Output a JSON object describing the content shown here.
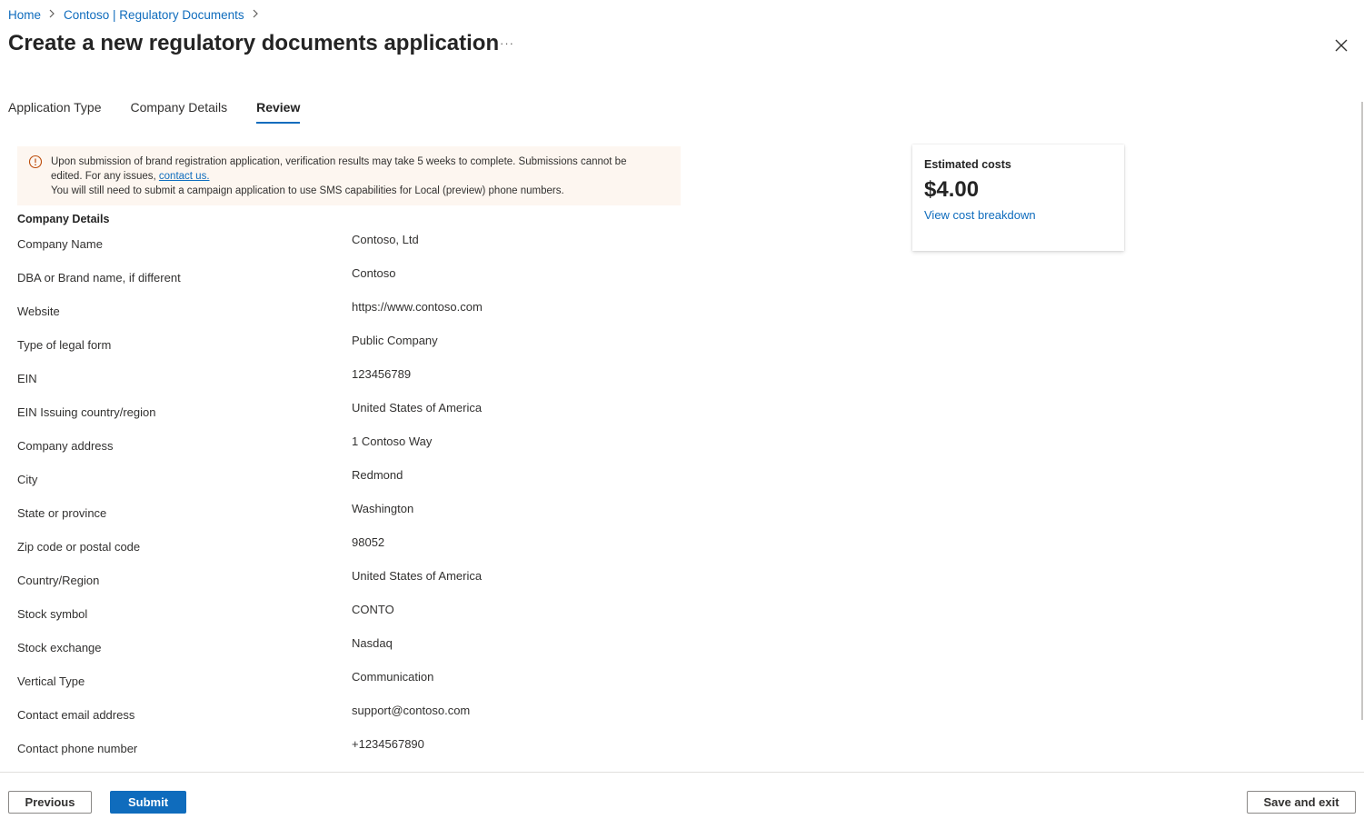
{
  "breadcrumb": {
    "items": [
      "Home",
      "Contoso | Regulatory Documents"
    ]
  },
  "page": {
    "title": "Create a new regulatory documents application",
    "more_label": "···"
  },
  "tabs": [
    {
      "label": "Application Type",
      "active": false
    },
    {
      "label": "Company Details",
      "active": false
    },
    {
      "label": "Review",
      "active": true
    }
  ],
  "warning": {
    "line1": "Upon submission of brand registration application, verification results may take 5 weeks to complete. Submissions cannot be",
    "line2_prefix": "edited. For any issues, ",
    "link": "contact us.",
    "line3": "You will still need to submit a campaign application to use SMS capabilities for Local (preview) phone numbers."
  },
  "company_details": {
    "title": "Company Details",
    "rows": [
      {
        "label": "Company Name",
        "value": "Contoso, Ltd"
      },
      {
        "label": "DBA or Brand name, if different",
        "value": "Contoso"
      },
      {
        "label": "Website",
        "value": "https://www.contoso.com"
      },
      {
        "label": "Type of legal form",
        "value": "Public Company"
      },
      {
        "label": "EIN",
        "value": "123456789"
      },
      {
        "label": "EIN Issuing country/region",
        "value": "United States of America"
      },
      {
        "label": "Company address",
        "value": "1 Contoso Way"
      },
      {
        "label": "City",
        "value": "Redmond"
      },
      {
        "label": "State or province",
        "value": "Washington"
      },
      {
        "label": "Zip code or postal code",
        "value": "98052"
      },
      {
        "label": "Country/Region",
        "value": "United States of America"
      },
      {
        "label": "Stock symbol",
        "value": "CONTO"
      },
      {
        "label": "Stock exchange",
        "value": "Nasdaq"
      },
      {
        "label": "Vertical Type",
        "value": "Communication"
      },
      {
        "label": "Contact email address",
        "value": "support@contoso.com"
      },
      {
        "label": "Contact phone number",
        "value": "+1234567890"
      }
    ]
  },
  "cost_card": {
    "label": "Estimated costs",
    "amount": "$4.00",
    "link": "View cost breakdown"
  },
  "footer": {
    "previous_label": "Previous",
    "submit_label": "Submit",
    "save_exit_label": "Save and exit"
  },
  "colors": {
    "accent": "#0f6cbd",
    "warning_bg": "#fdf6f0",
    "warning_icon": "#bc4b09"
  },
  "icons": {
    "breadcrumb_separator": "chevron-right-icon",
    "close": "close-icon",
    "warning": "warning-circle-icon"
  }
}
